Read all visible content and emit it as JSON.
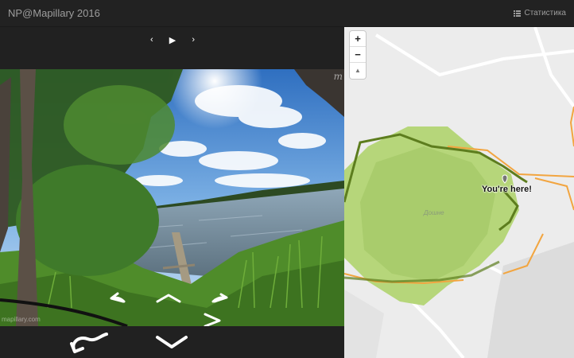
{
  "header": {
    "title": "NP@Mapillary 2016",
    "stats_label": "Статистика",
    "stats_icon": "list-icon"
  },
  "viewer": {
    "prev_glyph": "‹",
    "play_glyph": "▶",
    "next_glyph": "›",
    "watermark": "m",
    "photo_caption": "mapillary.com"
  },
  "map": {
    "zoom_in": "+",
    "zoom_out": "−",
    "compass": "▲",
    "place_name": "Дошне",
    "you_are_here": "You're here!"
  },
  "colors": {
    "navbar": "#222222",
    "map_bg": "#ececec",
    "area_fill": "#b6d67a",
    "track": "#5d7d1e",
    "road": "#f2a540"
  }
}
